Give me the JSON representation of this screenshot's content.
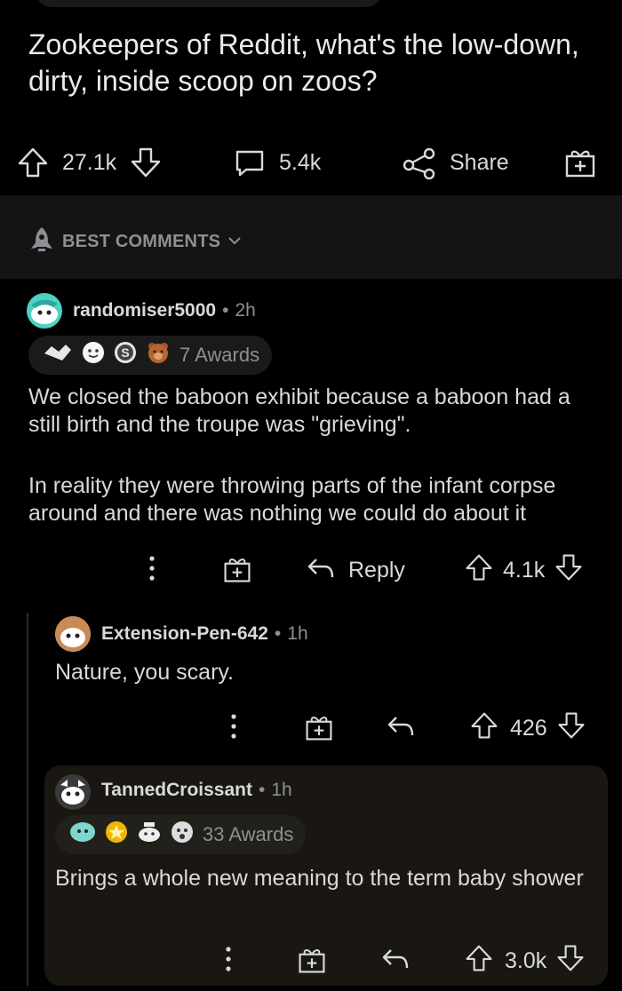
{
  "post": {
    "title": "Zookeepers of Reddit, what's the low-down, dirty, inside scoop on zoos?",
    "upvotes": "27.1k",
    "comments": "5.4k",
    "share_label": "Share"
  },
  "sort": {
    "label": "BEST COMMENTS"
  },
  "comments": [
    {
      "username": "randomiser5000",
      "time": "2h",
      "awards_label": "7 Awards",
      "body_p1": "We closed the baboon exhibit because a baboon had a still birth and the troupe was \"grieving\".",
      "body_p2": "In reality they were throwing parts of the infant corpse around and there was nothing we could do about it",
      "reply_label": "Reply",
      "votes": "4.1k"
    },
    {
      "username": "Extension-Pen-642",
      "time": "1h",
      "body": "Nature, you scary.",
      "votes": "426"
    },
    {
      "username": "TannedCroissant",
      "time": "1h",
      "awards_label": "33 Awards",
      "body": "Brings a whole new meaning to the term baby shower",
      "votes": "3.0k"
    }
  ],
  "icons": [
    "upvote-icon",
    "downvote-icon",
    "comment-icon",
    "share-icon",
    "gift-icon",
    "more-icon",
    "reply-icon",
    "chevron-down-icon",
    "rocket-icon"
  ],
  "colors": {
    "background": "#000000",
    "text": "#d7dadc",
    "muted": "#8c9095",
    "sort_bar": "#141415",
    "highlight": "#1a1712"
  }
}
